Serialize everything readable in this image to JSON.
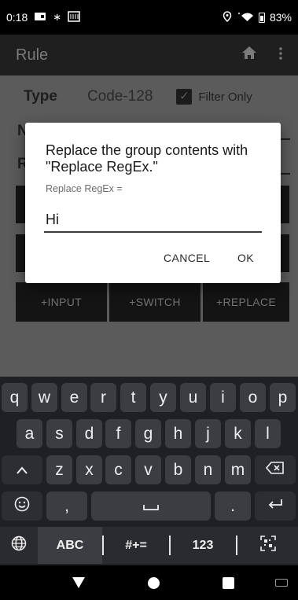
{
  "status_bar": {
    "time": "0:18",
    "battery": "83%"
  },
  "app_bar": {
    "title": "Rule"
  },
  "form": {
    "type_label": "Type",
    "type_value": "Code-128",
    "filter_only_label": "Filter Only",
    "filter_only_checked": true,
    "row2_label_partial": "N",
    "row3_label_partial": "R",
    "buttons": [
      "+INPUT",
      "+SWITCH",
      "+REPLACE"
    ]
  },
  "dialog": {
    "title": "Replace the group contents with \"Replace RegEx.\"",
    "subtitle": "Replace RegEx =",
    "input_value": "Hi",
    "cancel": "CANCEL",
    "ok": "OK"
  },
  "keyboard": {
    "row1": [
      "q",
      "w",
      "e",
      "r",
      "t",
      "y",
      "u",
      "i",
      "o",
      "p"
    ],
    "row2": [
      "a",
      "s",
      "d",
      "f",
      "g",
      "h",
      "j",
      "k",
      "l"
    ],
    "row3": [
      "z",
      "x",
      "c",
      "v",
      "b",
      "n",
      "m"
    ],
    "comma": ",",
    "period": ".",
    "bottom": {
      "abc": "ABC",
      "symbols": "#+=",
      "numbers": "123"
    }
  },
  "colors": {
    "dialog_bg": "#ffffff",
    "scrim": "#5b5b5b",
    "keyboard_bg": "#1f2024",
    "key_bg": "#3b3d43"
  }
}
